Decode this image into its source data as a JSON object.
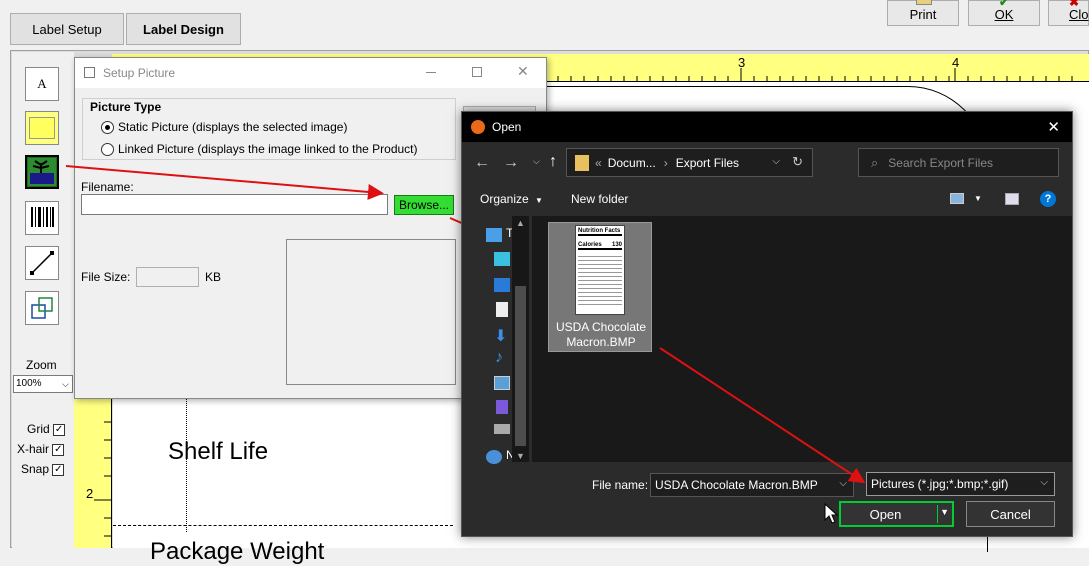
{
  "tabs": [
    {
      "label": "Label Setup"
    },
    {
      "label": "Label Design"
    }
  ],
  "top_buttons": {
    "print": "Print",
    "ok": "OK",
    "close": "Clo"
  },
  "toolbox": {
    "text_tool": "A",
    "zoom_label": "Zoom",
    "zoom_value": "100%",
    "grid_label": "Grid",
    "xhair_label": "X-hair",
    "snap_label": "Snap"
  },
  "ruler": {
    "top_marks": [
      "3",
      "4"
    ],
    "left_marks": [
      "2"
    ]
  },
  "canvas": {
    "shelf_life": "Shelf Life",
    "package_weight": "Package Weight"
  },
  "setup_dialog": {
    "title": "Setup Picture",
    "picture_type_label": "Picture Type",
    "static_option": "Static Picture (displays the selected image)",
    "linked_option": "Linked Picture (displays the image linked to the Product)",
    "filename_label": "Filename:",
    "filename_value": "",
    "browse_label": "Browse...",
    "file_size_label": "File Size:",
    "file_size_value": "",
    "kb_label": "KB"
  },
  "open_dialog": {
    "title": "Open",
    "breadcrumb_root": "Docum...",
    "breadcrumb_current": "Export Files",
    "search_placeholder": "Search Export Files",
    "organize_label": "Organize",
    "new_folder_label": "New folder",
    "nav_pane_labels": [
      "T",
      "N"
    ],
    "file_item": {
      "name": "USDA Chocolate Macron.BMP",
      "thumb_title": "Nutrition Facts",
      "thumb_calories_label": "Calories",
      "thumb_calories_value": "130"
    },
    "filename_label": "File name:",
    "filename_value": "USDA Chocolate Macron.BMP",
    "filetype_value": "Pictures (*.jpg;*.bmp;*.gif)",
    "open_label": "Open",
    "cancel_label": "Cancel"
  },
  "colors": {
    "ruler": "#ffff80",
    "browse_button": "#33dd33",
    "annotation_arrow": "#dd1111",
    "accent_blue": "#0078d7"
  }
}
